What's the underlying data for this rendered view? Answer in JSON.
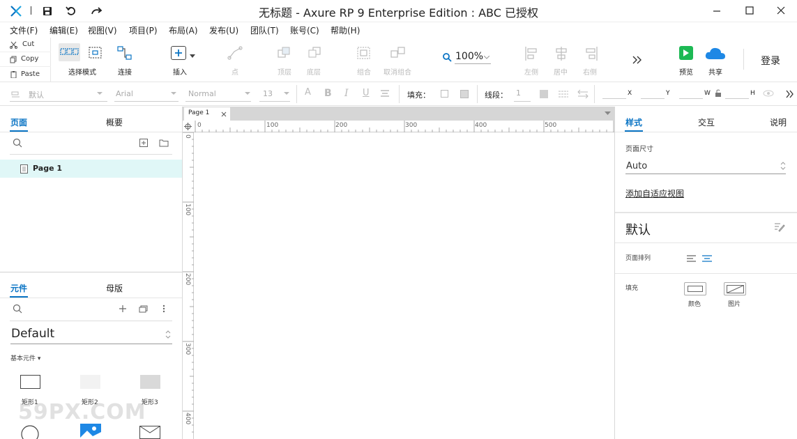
{
  "window": {
    "title": "无标题 - Axure RP 9 Enterprise Edition : ABC 已授权"
  },
  "menu": [
    "文件(F)",
    "编辑(E)",
    "视图(V)",
    "项目(P)",
    "布局(A)",
    "发布(U)",
    "团队(T)",
    "账号(C)",
    "帮助(H)"
  ],
  "clipboard": {
    "cut": "Cut",
    "copy": "Copy",
    "paste": "Paste"
  },
  "toolbar": {
    "select_mode": "选择模式",
    "connect": "连接",
    "insert": "插入",
    "point": "点",
    "top_layer": "顶层",
    "bottom_layer": "底层",
    "group": "组合",
    "ungroup": "取消组合",
    "zoom": "100%",
    "left": "左侧",
    "center": "居中",
    "right": "右侧",
    "preview": "预览",
    "share": "共享",
    "login": "登录"
  },
  "format": {
    "style": "默认",
    "font": "Arial",
    "weight": "Normal",
    "size": "13",
    "fill_label": "填充：",
    "line_label": "线段：",
    "line_value": "1",
    "x": "X",
    "y": "Y",
    "w": "W",
    "h": "H"
  },
  "pages_panel": {
    "tabs": [
      "页面",
      "概要"
    ],
    "items": [
      {
        "label": "Page 1"
      }
    ]
  },
  "library_panel": {
    "tabs": [
      "元件",
      "母版"
    ],
    "library": "Default",
    "category": "基本元件 ▾",
    "widgets": [
      "矩形1",
      "矩形2",
      "矩形3"
    ]
  },
  "canvas": {
    "tab": "Page 1",
    "ruler_h": [
      "0",
      "100",
      "200",
      "300",
      "400",
      "500"
    ],
    "ruler_v": [
      "0",
      "100",
      "200",
      "300",
      "400"
    ]
  },
  "right_panel": {
    "tabs": [
      "样式",
      "交互",
      "说明"
    ],
    "page_size_label": "页面尺寸",
    "page_size_value": "Auto",
    "adaptive_link": "添加自适应视图",
    "style_name": "默认",
    "page_align_label": "页面排列",
    "fill_label": "填充",
    "fill_color": "颜色",
    "fill_image": "图片"
  },
  "watermark": "59PX.COM",
  "colors": {
    "accent": "#0a74c4",
    "preview_green": "#1db954",
    "share_blue": "#1e88e5"
  }
}
